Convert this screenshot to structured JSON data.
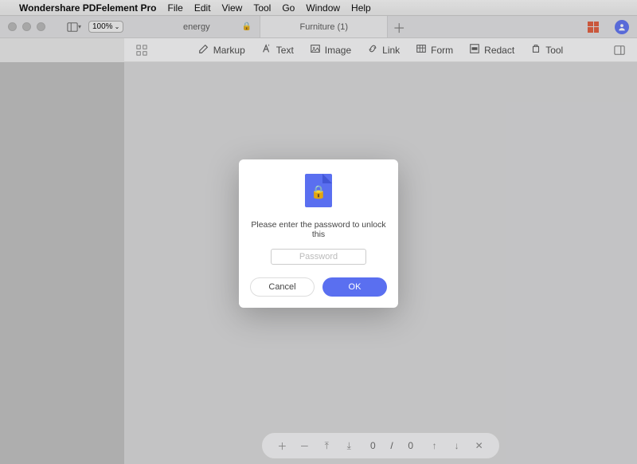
{
  "menubar": {
    "app_name": "Wondershare PDFelement Pro",
    "items": [
      "File",
      "Edit",
      "View",
      "Tool",
      "Go",
      "Window",
      "Help"
    ]
  },
  "titlebar": {
    "zoom_level": "100%",
    "tabs": [
      {
        "label": "energy",
        "locked": true
      },
      {
        "label": "Furniture (1)",
        "locked": false
      }
    ]
  },
  "toolbar": {
    "items": [
      {
        "icon": "markup-icon",
        "label": "Markup"
      },
      {
        "icon": "text-icon",
        "label": "Text"
      },
      {
        "icon": "image-icon",
        "label": "Image"
      },
      {
        "icon": "link-icon",
        "label": "Link"
      },
      {
        "icon": "form-icon",
        "label": "Form"
      },
      {
        "icon": "redact-icon",
        "label": "Redact"
      },
      {
        "icon": "tool-icon",
        "label": "Tool"
      }
    ]
  },
  "page_nav": {
    "current": "0",
    "separator": "/",
    "total": "0"
  },
  "modal": {
    "message": "Please enter the password to unlock this",
    "placeholder": "Password",
    "cancel_label": "Cancel",
    "ok_label": "OK"
  }
}
